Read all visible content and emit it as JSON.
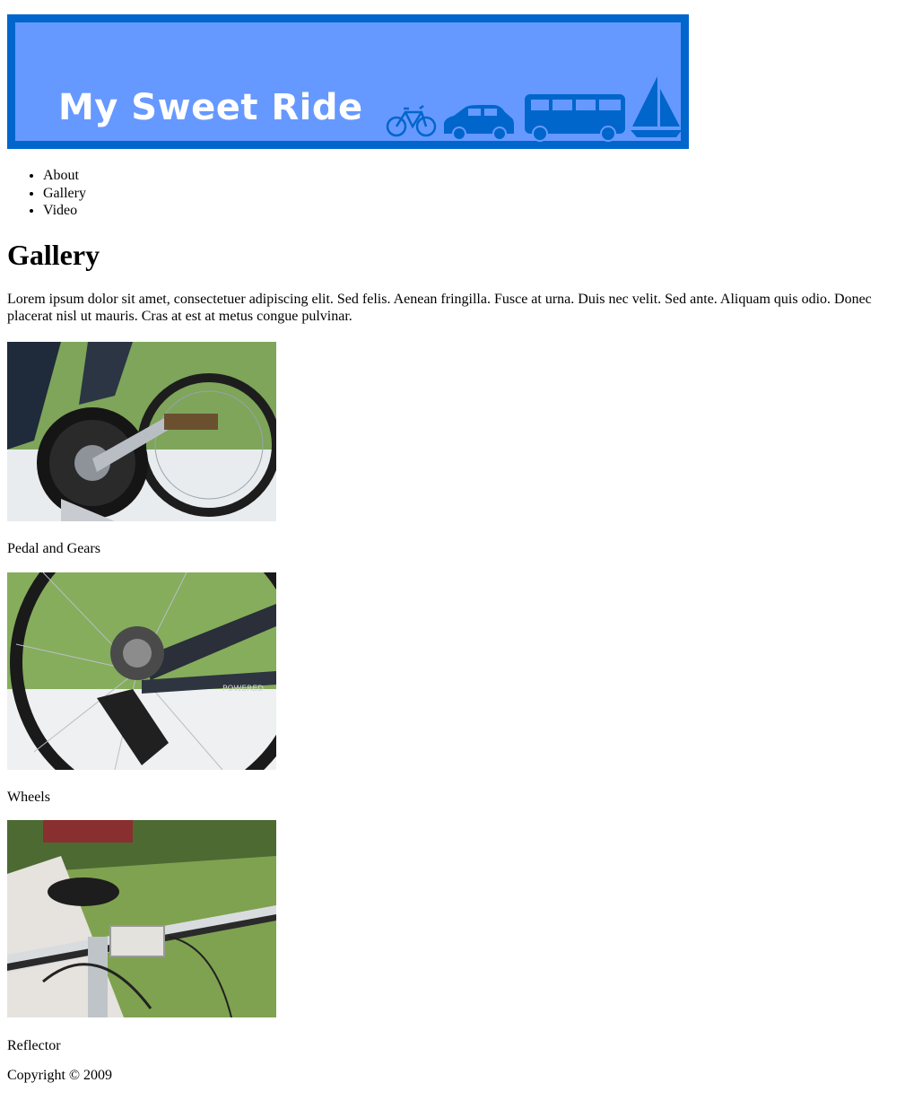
{
  "header": {
    "title": "My Sweet Ride",
    "icons": [
      "bicycle-icon",
      "car-icon",
      "bus-icon",
      "sailboat-icon"
    ],
    "colors": {
      "frame": "#0066cc",
      "fill": "#6699ff",
      "title": "#ffffff"
    }
  },
  "nav": {
    "items": [
      {
        "label": "About"
      },
      {
        "label": "Gallery"
      },
      {
        "label": "Video"
      }
    ]
  },
  "main": {
    "heading": "Gallery",
    "intro": "Lorem ipsum dolor sit amet, consectetuer adipiscing elit. Sed felis. Aenean fringilla. Fusce at urna. Duis nec velit. Sed ante. Aliquam quis odio. Donec placerat nisl ut mauris. Cras at est at metus congue pulvinar.",
    "gallery": [
      {
        "caption": "Pedal and Gears"
      },
      {
        "caption": "Wheels"
      },
      {
        "caption": "Reflector"
      }
    ]
  },
  "footer": {
    "text": "Copyright © 2009"
  }
}
